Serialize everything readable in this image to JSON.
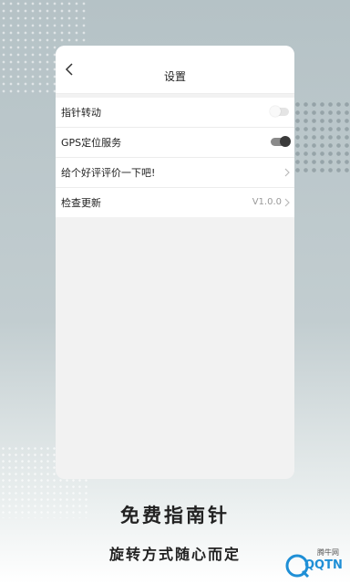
{
  "screen": {
    "title": "设置",
    "rows": [
      {
        "label": "指针转动",
        "control": "toggle",
        "state": "off"
      },
      {
        "label": "GPS定位服务",
        "control": "toggle",
        "state": "on"
      },
      {
        "label": "给个好评评价一下吧!",
        "control": "chevron"
      },
      {
        "label": "检查更新",
        "control": "chevron",
        "value": "V1.0.0"
      }
    ]
  },
  "promo": {
    "headline": "免费指南针",
    "subline": "旋转方式随心而定"
  },
  "watermark": {
    "text": "QQTN",
    "site": "腾牛网"
  },
  "colors": {
    "background": "#b5c2c6",
    "toggle_on": "#3a3a3a",
    "toggle_off": "#e4e4e4",
    "watermark": "#1f8fd6"
  }
}
